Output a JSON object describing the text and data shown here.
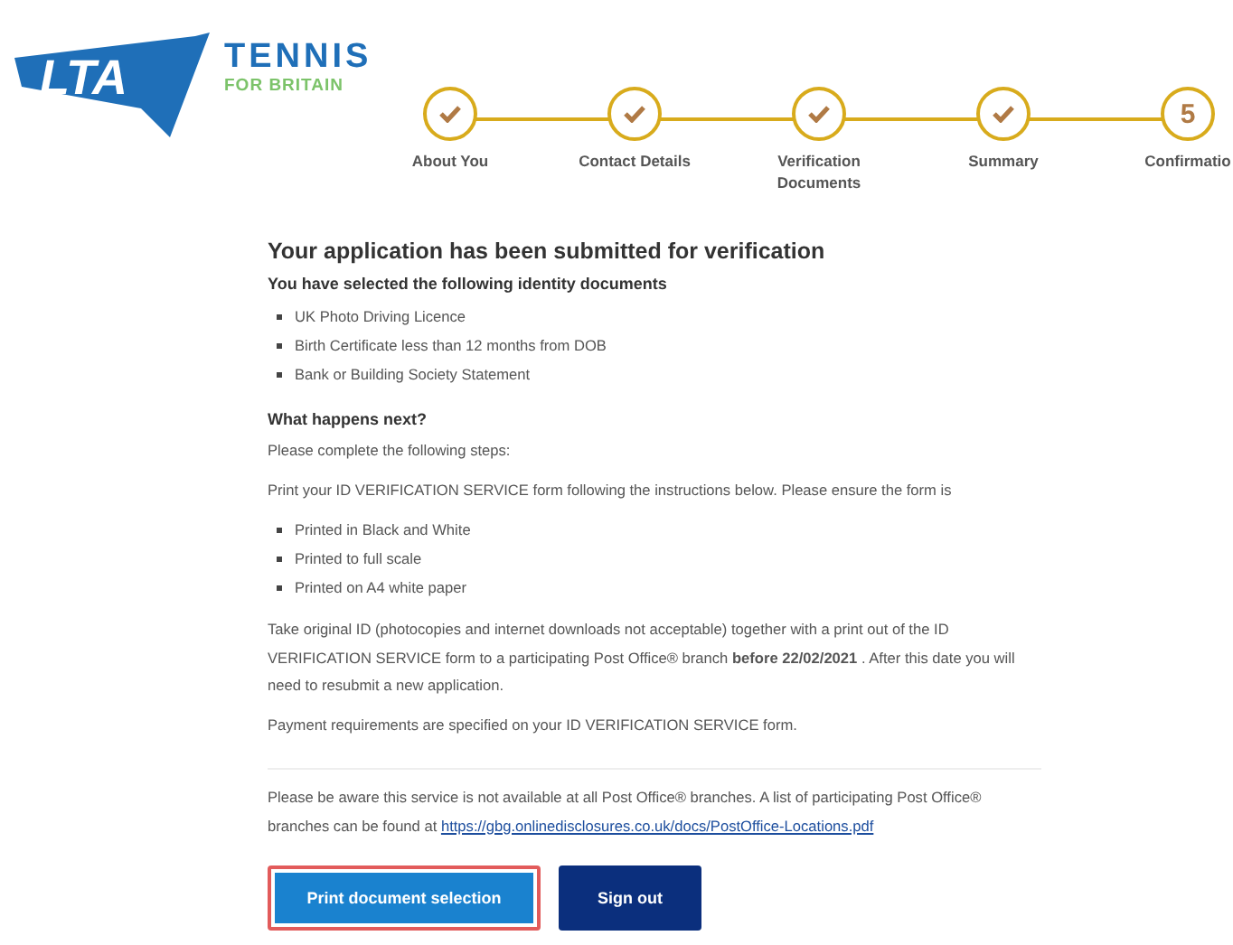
{
  "logo": {
    "mark": "LTA",
    "title": "TENNIS",
    "subtitle": "FOR BRITAIN"
  },
  "steps": [
    {
      "label": "About You",
      "completed": true
    },
    {
      "label": "Contact Details",
      "completed": true
    },
    {
      "label": "Verification Documents",
      "completed": true
    },
    {
      "label": "Summary",
      "completed": true
    },
    {
      "label": "Confirmatio",
      "completed": false,
      "number": "5"
    }
  ],
  "heading": "Your application has been submitted for verification",
  "documents_heading": "You have selected the following identity documents",
  "documents": [
    "UK Photo Driving Licence",
    "Birth Certificate less than 12 months from DOB",
    "Bank or Building Society Statement"
  ],
  "next_heading": "What happens next?",
  "intro": "Please complete the following steps:",
  "print_instruction": "Print your ID VERIFICATION SERVICE form following the instructions below. Please ensure the form is",
  "print_requirements": [
    "Printed in Black and White",
    "Printed to full scale",
    "Printed on A4 white paper"
  ],
  "deadline_text": "Take original ID (photocopies and internet downloads not acceptable) together with a print out of the ID VERIFICATION SERVICE form to a participating Post Office® branch **before 22/02/2021** . After this date you will need to resubmit a new application.",
  "payment_text": "Payment requirements are specified on your ID VERIFICATION SERVICE form.",
  "notice": {
    "text": "Please be aware this service is not available at all Post Office® branches. A list of participating Post Office® branches can be found at",
    "link": "https://gbg.onlinedisclosures.co.uk/docs/PostOffice-Locations.pdf"
  },
  "buttons": [
    {
      "label": "Print document selection",
      "kind": "primary",
      "focused": true
    },
    {
      "label": "Sign out",
      "kind": "dark",
      "focused": false
    }
  ]
}
